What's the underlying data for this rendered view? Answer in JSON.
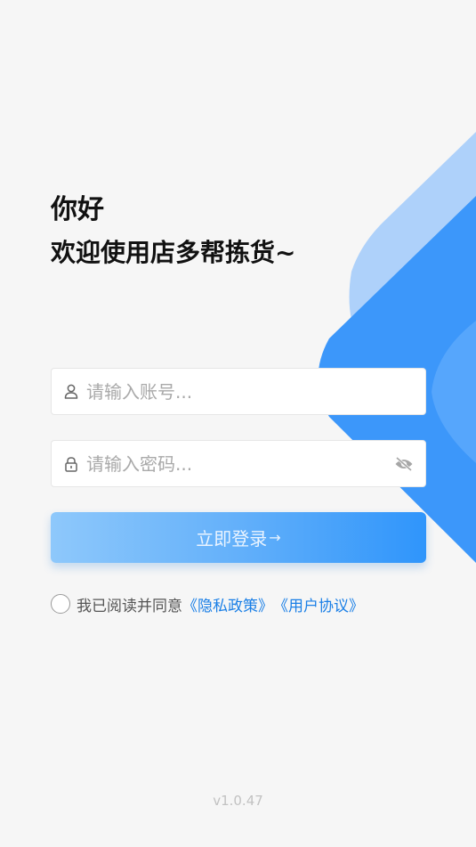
{
  "greeting": {
    "line1": "你好",
    "line2": "欢迎使用店多帮拣货~"
  },
  "account": {
    "placeholder": "请输入账号...",
    "icon": "user-icon"
  },
  "password": {
    "placeholder": "请输入密码...",
    "icon": "lock-icon",
    "toggle_icon": "eye-off-icon"
  },
  "login_button": {
    "label": "立即登录",
    "arrow": "→"
  },
  "agreement": {
    "prefix": "我已阅读并同意",
    "privacy_label": "《隐私政策》",
    "terms_label": "《用户协议》"
  },
  "version": "v1.0.47",
  "colors": {
    "link": "#1a7fe6",
    "button_start": "#8ec8fb",
    "button_end": "#2f95fb",
    "deco_light": "#aed1fa",
    "deco_dark": "#3c97fa"
  }
}
